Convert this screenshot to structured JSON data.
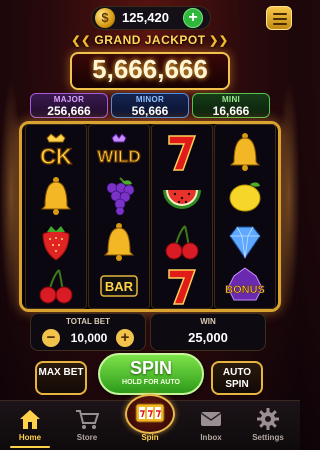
{
  "header": {
    "coins": "125,420",
    "coin_symbol": "$",
    "add_label": "+"
  },
  "jackpot": {
    "title": "GRAND JACKPOT",
    "value": "5,666,666"
  },
  "mini_jackpots": [
    {
      "label": "MAJOR",
      "value": "256,666",
      "color": "#a45cd8"
    },
    {
      "label": "MINOR",
      "value": "56,666",
      "color": "#4b8fe0"
    },
    {
      "label": "MINI",
      "value": "16,666",
      "color": "#56c14d"
    }
  ],
  "reels": {
    "symbols": [
      [
        "ck-logo",
        "wild",
        "seven",
        "bell"
      ],
      [
        "bell",
        "grapes",
        "watermelon",
        "lemon"
      ],
      [
        "strawberry",
        "bell",
        "cherries",
        "diamond"
      ],
      [
        "cherries",
        "bar",
        "seven",
        "bonus"
      ]
    ],
    "labels": {
      "ck": "CK",
      "wild": "WILD",
      "bar": "BAR",
      "bonus": "BONUS"
    }
  },
  "bet": {
    "label": "TOTAL BET",
    "value": "10,000",
    "minus": "−",
    "plus": "+"
  },
  "win": {
    "label": "WIN",
    "value": "25,000"
  },
  "controls": {
    "max_bet": "MAX BET",
    "spin": "SPIN",
    "spin_sub": "HOLD FOR AUTO",
    "auto_spin": "AUTO SPIN"
  },
  "nav": {
    "home": "Home",
    "store": "Store",
    "spin": "Spin",
    "inbox": "Inbox",
    "settings": "Settings",
    "active": "home"
  },
  "colors": {
    "gold": "#f1c24c",
    "spin_green": "#4cc22a",
    "background": "#2a0a0c"
  }
}
